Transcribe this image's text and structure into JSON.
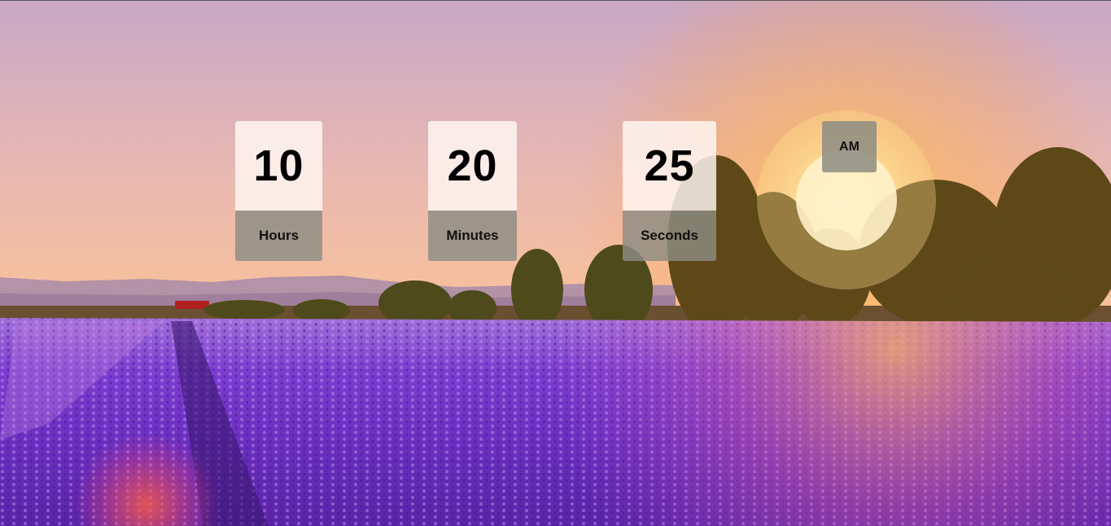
{
  "clock": {
    "hours": {
      "value": "10",
      "label": "Hours"
    },
    "minutes": {
      "value": "20",
      "label": "Minutes"
    },
    "seconds": {
      "value": "25",
      "label": "Seconds"
    },
    "period": "AM"
  },
  "colors": {
    "sky_top": "#c8a8c8",
    "sky_horizon": "#ffc890",
    "sun": "#fff6c8",
    "lavender": "#7a3fcf",
    "trees": "#5a4418"
  }
}
